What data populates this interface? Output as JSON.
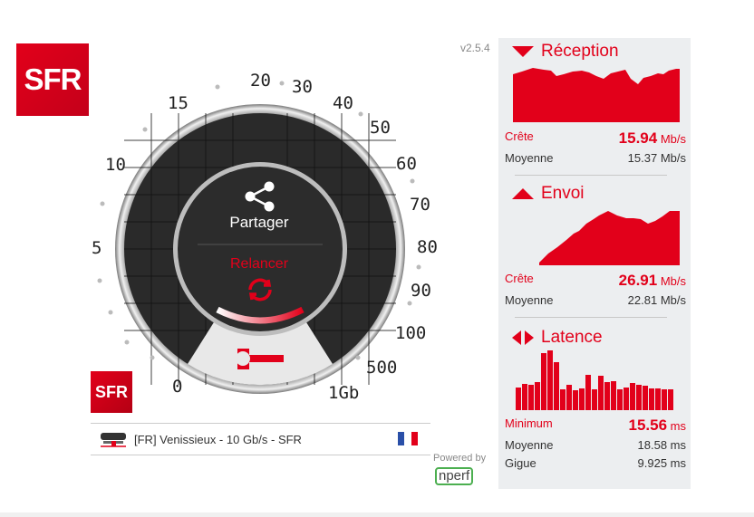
{
  "app": {
    "version": "v2.5.4"
  },
  "logos": {
    "big": "SFR",
    "small": "SFR"
  },
  "gauge": {
    "ticks": [
      {
        "label": "0"
      },
      {
        "label": "5"
      },
      {
        "label": "10"
      },
      {
        "label": "15"
      },
      {
        "label": "20"
      },
      {
        "label": "30"
      },
      {
        "label": "40"
      },
      {
        "label": "50"
      },
      {
        "label": "60"
      },
      {
        "label": "70"
      },
      {
        "label": "80"
      },
      {
        "label": "90"
      },
      {
        "label": "100"
      },
      {
        "label": "500"
      },
      {
        "label": "1Gb"
      }
    ],
    "share_label": "Partager",
    "restart_label": "Relancer"
  },
  "server": {
    "label": "[FR] Venissieux - 10 Gb/s - SFR"
  },
  "powered": {
    "label": "Powered by",
    "brand": "nperf"
  },
  "results": {
    "download": {
      "title": "Réception",
      "peak_label": "Crête",
      "peak_value": "15.94",
      "peak_unit": "Mb/s",
      "avg_label": "Moyenne",
      "avg_value": "15.37 Mb/s"
    },
    "upload": {
      "title": "Envoi",
      "peak_label": "Crête",
      "peak_value": "26.91",
      "peak_unit": "Mb/s",
      "avg_label": "Moyenne",
      "avg_value": "22.81 Mb/s"
    },
    "latency": {
      "title": "Latence",
      "min_label": "Minimum",
      "min_value": "15.56",
      "min_unit": "ms",
      "avg_label": "Moyenne",
      "avg_value": "18.58 ms",
      "jitter_label": "Gigue",
      "jitter_value": "9.925 ms"
    }
  },
  "colors": {
    "brand": "#e2001a",
    "dial": "#2a2a2a",
    "panel": "#eceef0"
  }
}
